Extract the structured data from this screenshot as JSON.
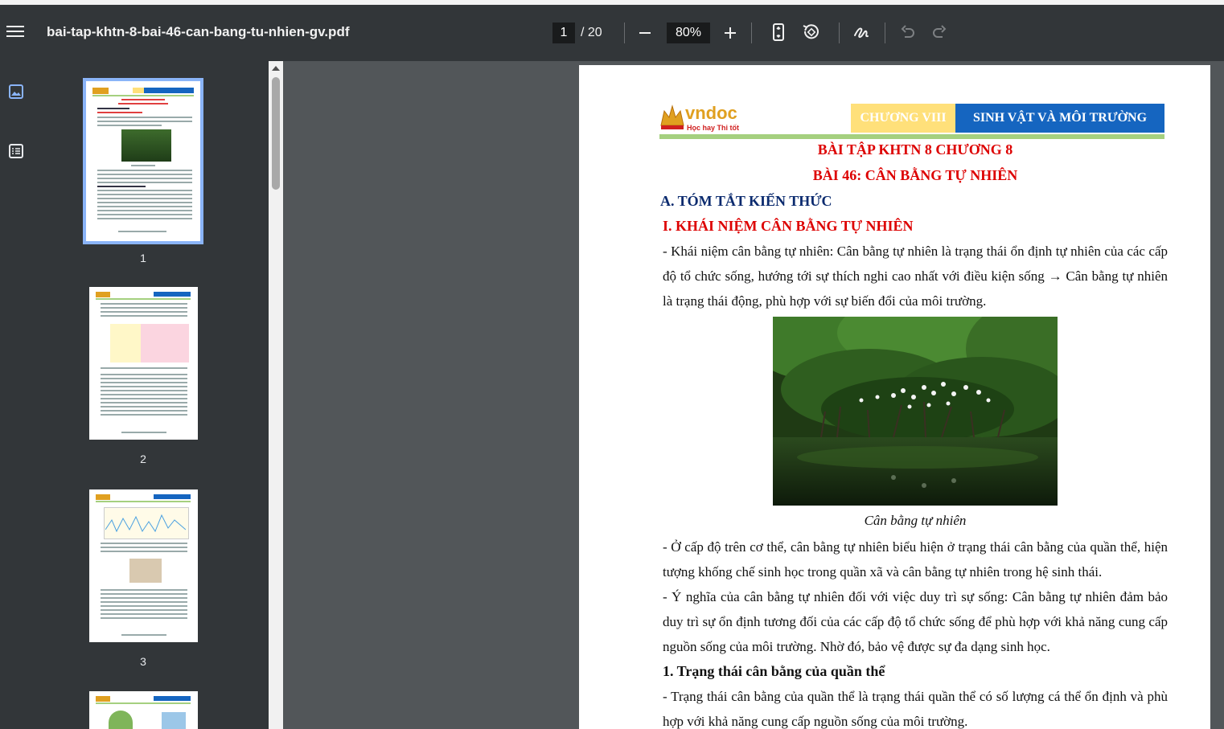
{
  "toolbar": {
    "filename": "bai-tap-khtn-8-bai-46-can-bang-tu-nhien-gv.pdf",
    "current_page": "1",
    "total_pages": "/ 20",
    "zoom": "80%"
  },
  "thumbnails": [
    {
      "label": "1"
    },
    {
      "label": "2"
    },
    {
      "label": "3"
    }
  ],
  "page": {
    "logo_text": "vndoc",
    "logo_tagline": "Học hay Thi tốt",
    "chapter": "CHƯƠNG VIII",
    "chapter_title": "SINH VẬT VÀ MÔI TRƯỜNG",
    "title1": "BÀI TẬP KHTN 8 CHƯƠNG 8",
    "title2": "BÀI 46: CÂN BẰNG TỰ NHIÊN",
    "section_a": "A. TÓM TẮT KIẾN THỨC",
    "section_i": "I. KHÁI NIỆM CÂN BẰNG TỰ NHIÊN",
    "para1": "- Khái niệm cân bằng tự nhiên: Cân bằng tự nhiên là trạng thái ổn định tự nhiên của các cấp độ tổ chức sống, hướng tới sự thích nghi cao nhất với điều kiện sống → Cân bằng tự nhiên là trạng thái động, phù hợp với sự biến đổi của môi trường.",
    "caption": "Cân bằng tự nhiên",
    "para2": "- Ở cấp độ trên cơ thể, cân bằng tự nhiên biểu hiện ở trạng thái cân bằng của quần thể, hiện tượng khống chế sinh học trong quần xã và cân bằng tự nhiên trong hệ sinh thái.",
    "para3": "- Ý nghĩa của cân bằng tự nhiên đối với việc duy trì sự sống: Cân bằng tự nhiên đảm bảo duy trì sự ổn định tương đối của các cấp độ tổ chức sống để phù hợp với khả năng cung cấp nguồn sống của môi trường. Nhờ đó, bảo vệ được sự đa dạng sinh học.",
    "heading1": "1. Trạng thái cân bằng của quần thể",
    "para4": "- Trạng thái cân bằng của quần thể là trạng thái quần thể có số lượng cá thể ổn định và phù hợp với khả năng cung cấp nguồn sống của môi trường."
  },
  "colors": {
    "toolbar_bg": "#323639",
    "viewer_bg": "#525659",
    "chapter_yellow": "#ffe07a",
    "chapter_blue": "#1565c0",
    "title_red": "#d00000",
    "heading_navy": "#0a2a6e",
    "selected_thumb": "#8ab4f8"
  }
}
